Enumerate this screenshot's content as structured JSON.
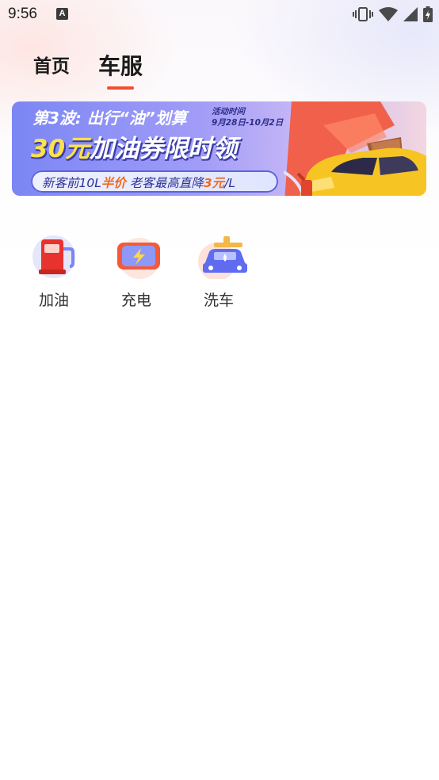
{
  "status_bar": {
    "time": "9:56",
    "notification_icon": "a-notification-icon",
    "icons": [
      "vibrate-icon",
      "wifi-icon",
      "cellular-signal-icon",
      "battery-charging-icon"
    ]
  },
  "nav": {
    "tabs": [
      {
        "label": "首页",
        "active": false
      },
      {
        "label": "车服",
        "active": true
      }
    ],
    "indicator_color": "#f04f2f"
  },
  "banner": {
    "round_label": "第3波: 出行“油”划算",
    "period_label": "活动时间",
    "period_dates": "9月28日-10月2日",
    "headline_amount": "30元",
    "headline_rest": "加油券限时领",
    "strip_part1": "新客前10L",
    "strip_highlight1": "半价",
    "strip_part2": "  老客最高直降",
    "strip_highlight2": "3元",
    "strip_part3": "/L",
    "colors": {
      "accent_yellow": "#ffe14a",
      "accent_orange": "#ef6a1d",
      "background_start": "#7b86f4"
    }
  },
  "services": [
    {
      "label": "加油",
      "icon": "fuel-pump-icon"
    },
    {
      "label": "充电",
      "icon": "battery-charge-icon"
    },
    {
      "label": "洗车",
      "icon": "car-wash-icon"
    }
  ]
}
